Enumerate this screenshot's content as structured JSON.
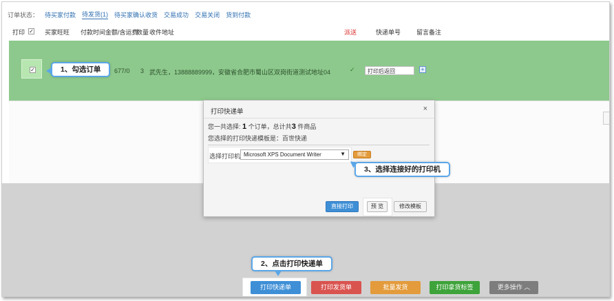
{
  "status": {
    "label": "订单状态：",
    "tabs": [
      "待买家付款",
      "待发货(1)",
      "待买家确认收货",
      "交易成功",
      "交易关闭",
      "货到付款"
    ]
  },
  "table_header": {
    "print": "打印",
    "buyer": "买家旺旺",
    "pay_time": "付款时间",
    "amount": "金额/含运费",
    "qty": "数量",
    "address": "收件地址",
    "ship": "派送",
    "tracking": "快递单号",
    "remark": "留言备注"
  },
  "order_row": {
    "amount": "677/0",
    "qty": "3",
    "address": "武先生，13888889999，安徽省合肥市蜀山区双岗街道测试地址04",
    "check": "✓",
    "tracking_value": "打印后返回"
  },
  "callouts": {
    "step1": "1、勾选订单",
    "step2": "2、点击打印快递单",
    "step3": "3、选择连接好的打印机"
  },
  "dialog": {
    "title": "打印快递单",
    "close": "×",
    "summary_prefix": "您一共选择:",
    "order_count": "1",
    "summary_mid": "个订单，总计共",
    "item_count": "3",
    "summary_suffix": "件商品",
    "template_line": "您选择的打印快递模板是：百世快递",
    "printer_label": "选择打印机：",
    "printer_value": "Microsoft XPS Document Writer",
    "bind_label": "绑定",
    "direct_print": "直接打印",
    "preview": "预 览",
    "edit_template": "修改模板"
  },
  "actions": {
    "print_express": "打印快递单",
    "print_ship": "打印发货单",
    "batch_ship": "批量发货",
    "print_label": "打印拿货标签",
    "more": "更多操作 ︿"
  },
  "colors": {
    "row_highlight": "#8dc98c",
    "blue": "#3e8fd6",
    "red": "#d9534f",
    "orange": "#e39b3b",
    "green": "#3ea33a",
    "gray": "#7d7d7d"
  }
}
